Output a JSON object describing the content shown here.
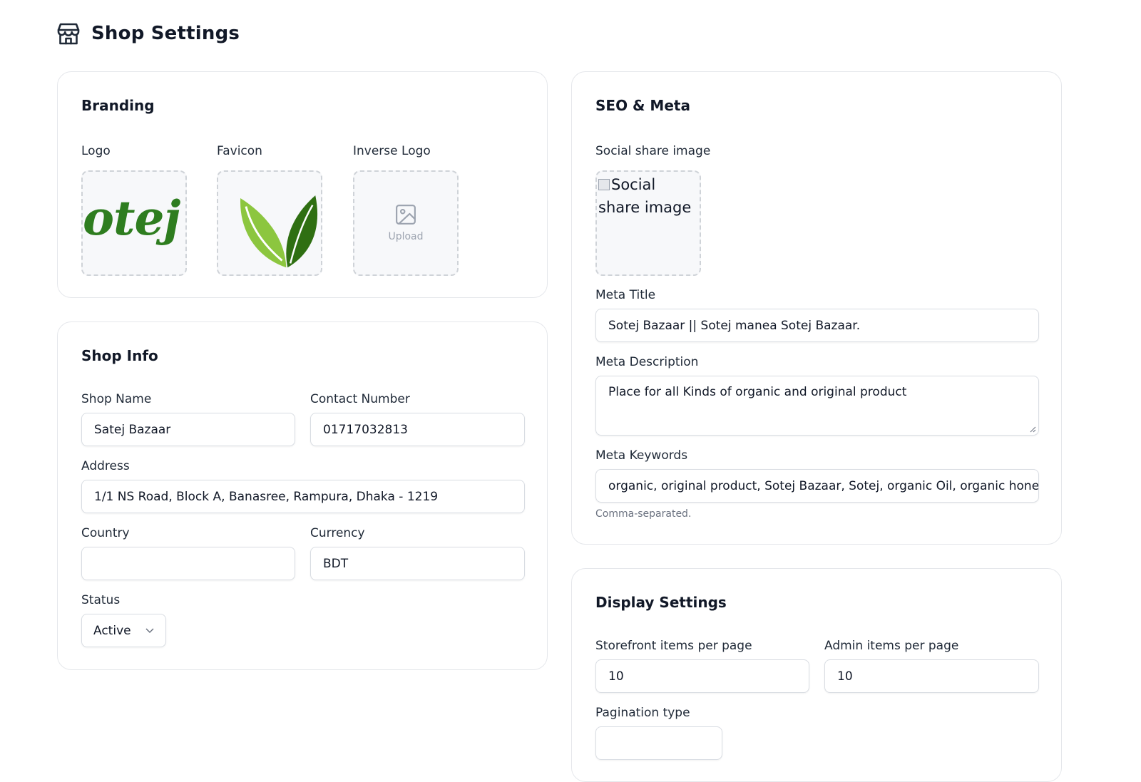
{
  "page": {
    "title": "Shop Settings",
    "icon": "store-icon"
  },
  "branding": {
    "title": "Branding",
    "logo_label": "Logo",
    "favicon_label": "Favicon",
    "inverse_logo_label": "Inverse Logo",
    "logo_text": "otej i",
    "upload_text": "Upload"
  },
  "shop_info": {
    "title": "Shop Info",
    "shop_name_label": "Shop Name",
    "shop_name_value": "Satej Bazaar",
    "contact_label": "Contact Number",
    "contact_value": "01717032813",
    "address_label": "Address",
    "address_value": "1/1 NS Road, Block A, Banasree, Rampura, Dhaka - 1219",
    "country_label": "Country",
    "country_value": "",
    "currency_label": "Currency",
    "currency_value": "BDT",
    "status_label": "Status",
    "status_value": "Active"
  },
  "seo": {
    "title": "SEO & Meta",
    "social_image_label": "Social share image",
    "social_image_alt": "Social share image",
    "meta_title_label": "Meta Title",
    "meta_title_value": "Sotej Bazaar || Sotej manea Sotej Bazaar.",
    "meta_description_label": "Meta Description",
    "meta_description_value": "Place for all Kinds of organic and original product",
    "meta_keywords_label": "Meta Keywords",
    "meta_keywords_value": "organic, original product, Sotej Bazaar, Sotej, organic Oil, organic honey",
    "keywords_hint": "Comma-separated."
  },
  "display": {
    "title": "Display Settings",
    "storefront_label": "Storefront items per page",
    "storefront_value": "10",
    "admin_label": "Admin items per page",
    "admin_value": "10",
    "pagination_label": "Pagination type"
  },
  "colors": {
    "logo_green": "#2e7d1f",
    "leaf_light": "#8cc63f",
    "leaf_dark": "#2f6f12",
    "border": "#e5e7eb",
    "dashed": "#cfd3d8"
  }
}
